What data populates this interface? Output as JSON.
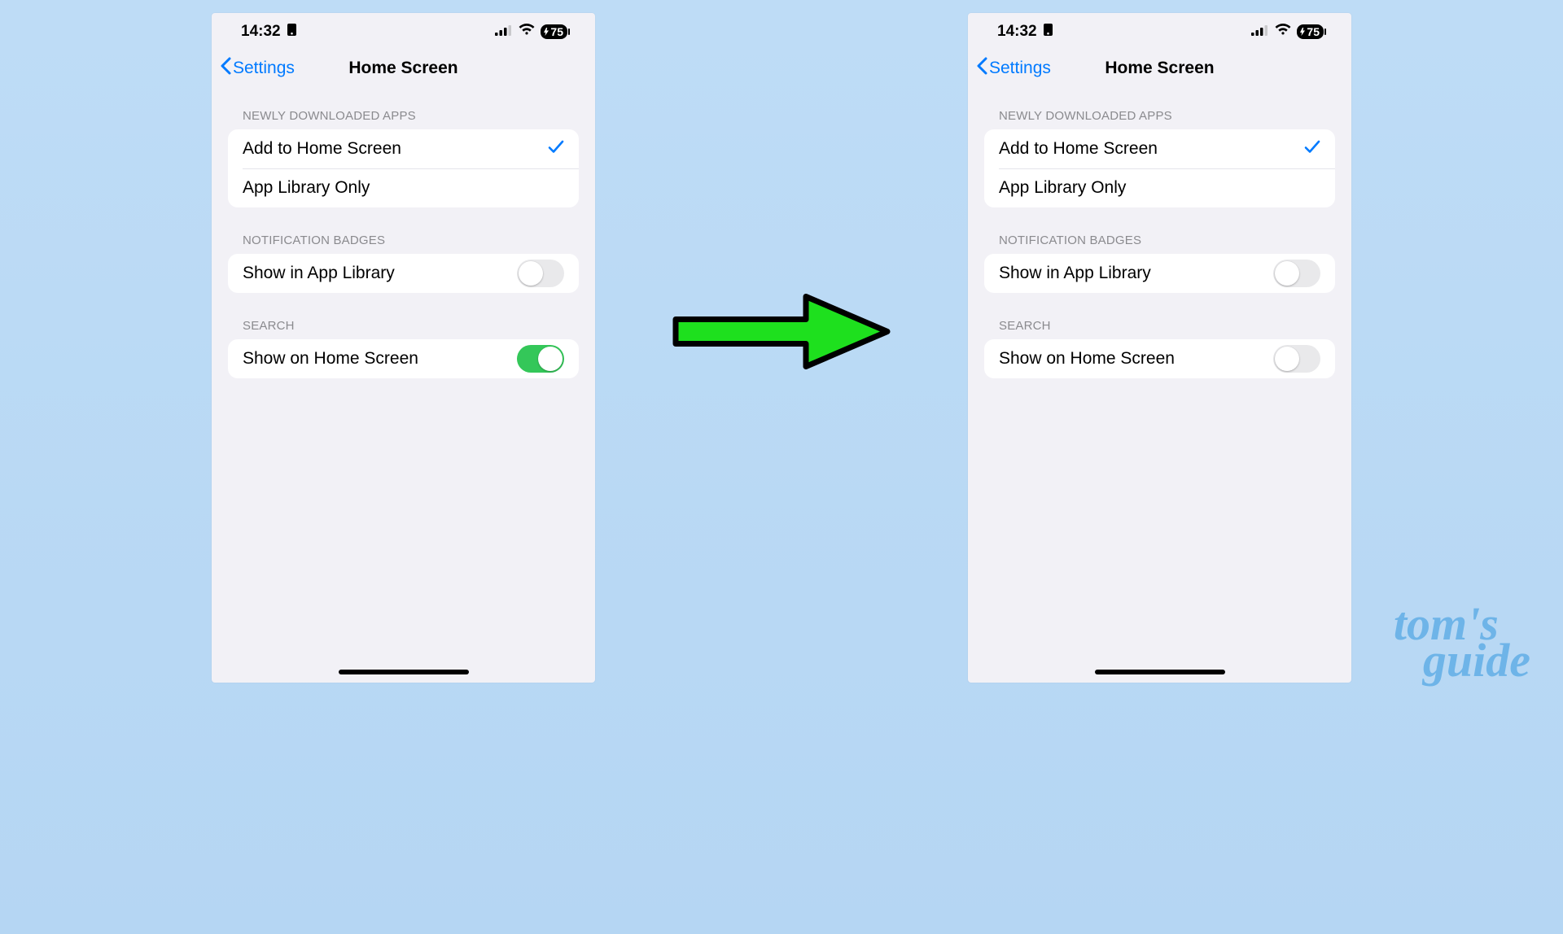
{
  "status": {
    "time": "14:32",
    "battery": "75"
  },
  "nav": {
    "back": "Settings",
    "title": "Home Screen"
  },
  "sections": {
    "downloads": {
      "header": "NEWLY DOWNLOADED APPS",
      "opt1": "Add to Home Screen",
      "opt2": "App Library Only"
    },
    "badges": {
      "header": "NOTIFICATION BADGES",
      "row": "Show in App Library"
    },
    "search": {
      "header": "SEARCH",
      "row": "Show on Home Screen"
    }
  },
  "watermark": {
    "line1": "tom's",
    "line2": "guide"
  }
}
